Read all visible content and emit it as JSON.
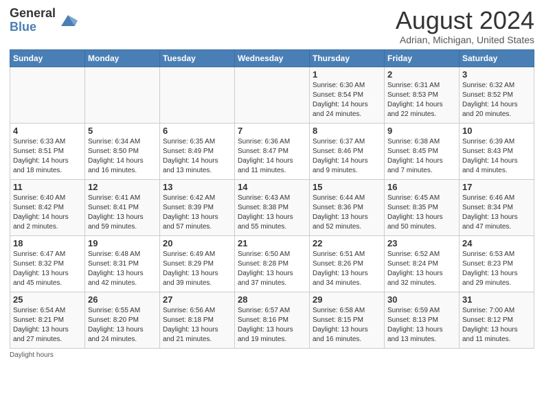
{
  "header": {
    "logo_general": "General",
    "logo_blue": "Blue",
    "title": "August 2024",
    "location": "Adrian, Michigan, United States"
  },
  "days_of_week": [
    "Sunday",
    "Monday",
    "Tuesday",
    "Wednesday",
    "Thursday",
    "Friday",
    "Saturday"
  ],
  "weeks": [
    [
      {
        "day": "",
        "info": ""
      },
      {
        "day": "",
        "info": ""
      },
      {
        "day": "",
        "info": ""
      },
      {
        "day": "",
        "info": ""
      },
      {
        "day": "1",
        "info": "Sunrise: 6:30 AM\nSunset: 8:54 PM\nDaylight: 14 hours and 24 minutes."
      },
      {
        "day": "2",
        "info": "Sunrise: 6:31 AM\nSunset: 8:53 PM\nDaylight: 14 hours and 22 minutes."
      },
      {
        "day": "3",
        "info": "Sunrise: 6:32 AM\nSunset: 8:52 PM\nDaylight: 14 hours and 20 minutes."
      }
    ],
    [
      {
        "day": "4",
        "info": "Sunrise: 6:33 AM\nSunset: 8:51 PM\nDaylight: 14 hours and 18 minutes."
      },
      {
        "day": "5",
        "info": "Sunrise: 6:34 AM\nSunset: 8:50 PM\nDaylight: 14 hours and 16 minutes."
      },
      {
        "day": "6",
        "info": "Sunrise: 6:35 AM\nSunset: 8:49 PM\nDaylight: 14 hours and 13 minutes."
      },
      {
        "day": "7",
        "info": "Sunrise: 6:36 AM\nSunset: 8:47 PM\nDaylight: 14 hours and 11 minutes."
      },
      {
        "day": "8",
        "info": "Sunrise: 6:37 AM\nSunset: 8:46 PM\nDaylight: 14 hours and 9 minutes."
      },
      {
        "day": "9",
        "info": "Sunrise: 6:38 AM\nSunset: 8:45 PM\nDaylight: 14 hours and 7 minutes."
      },
      {
        "day": "10",
        "info": "Sunrise: 6:39 AM\nSunset: 8:43 PM\nDaylight: 14 hours and 4 minutes."
      }
    ],
    [
      {
        "day": "11",
        "info": "Sunrise: 6:40 AM\nSunset: 8:42 PM\nDaylight: 14 hours and 2 minutes."
      },
      {
        "day": "12",
        "info": "Sunrise: 6:41 AM\nSunset: 8:41 PM\nDaylight: 13 hours and 59 minutes."
      },
      {
        "day": "13",
        "info": "Sunrise: 6:42 AM\nSunset: 8:39 PM\nDaylight: 13 hours and 57 minutes."
      },
      {
        "day": "14",
        "info": "Sunrise: 6:43 AM\nSunset: 8:38 PM\nDaylight: 13 hours and 55 minutes."
      },
      {
        "day": "15",
        "info": "Sunrise: 6:44 AM\nSunset: 8:36 PM\nDaylight: 13 hours and 52 minutes."
      },
      {
        "day": "16",
        "info": "Sunrise: 6:45 AM\nSunset: 8:35 PM\nDaylight: 13 hours and 50 minutes."
      },
      {
        "day": "17",
        "info": "Sunrise: 6:46 AM\nSunset: 8:34 PM\nDaylight: 13 hours and 47 minutes."
      }
    ],
    [
      {
        "day": "18",
        "info": "Sunrise: 6:47 AM\nSunset: 8:32 PM\nDaylight: 13 hours and 45 minutes."
      },
      {
        "day": "19",
        "info": "Sunrise: 6:48 AM\nSunset: 8:31 PM\nDaylight: 13 hours and 42 minutes."
      },
      {
        "day": "20",
        "info": "Sunrise: 6:49 AM\nSunset: 8:29 PM\nDaylight: 13 hours and 39 minutes."
      },
      {
        "day": "21",
        "info": "Sunrise: 6:50 AM\nSunset: 8:28 PM\nDaylight: 13 hours and 37 minutes."
      },
      {
        "day": "22",
        "info": "Sunrise: 6:51 AM\nSunset: 8:26 PM\nDaylight: 13 hours and 34 minutes."
      },
      {
        "day": "23",
        "info": "Sunrise: 6:52 AM\nSunset: 8:24 PM\nDaylight: 13 hours and 32 minutes."
      },
      {
        "day": "24",
        "info": "Sunrise: 6:53 AM\nSunset: 8:23 PM\nDaylight: 13 hours and 29 minutes."
      }
    ],
    [
      {
        "day": "25",
        "info": "Sunrise: 6:54 AM\nSunset: 8:21 PM\nDaylight: 13 hours and 27 minutes."
      },
      {
        "day": "26",
        "info": "Sunrise: 6:55 AM\nSunset: 8:20 PM\nDaylight: 13 hours and 24 minutes."
      },
      {
        "day": "27",
        "info": "Sunrise: 6:56 AM\nSunset: 8:18 PM\nDaylight: 13 hours and 21 minutes."
      },
      {
        "day": "28",
        "info": "Sunrise: 6:57 AM\nSunset: 8:16 PM\nDaylight: 13 hours and 19 minutes."
      },
      {
        "day": "29",
        "info": "Sunrise: 6:58 AM\nSunset: 8:15 PM\nDaylight: 13 hours and 16 minutes."
      },
      {
        "day": "30",
        "info": "Sunrise: 6:59 AM\nSunset: 8:13 PM\nDaylight: 13 hours and 13 minutes."
      },
      {
        "day": "31",
        "info": "Sunrise: 7:00 AM\nSunset: 8:12 PM\nDaylight: 13 hours and 11 minutes."
      }
    ]
  ],
  "footer": {
    "daylight_label": "Daylight hours"
  }
}
